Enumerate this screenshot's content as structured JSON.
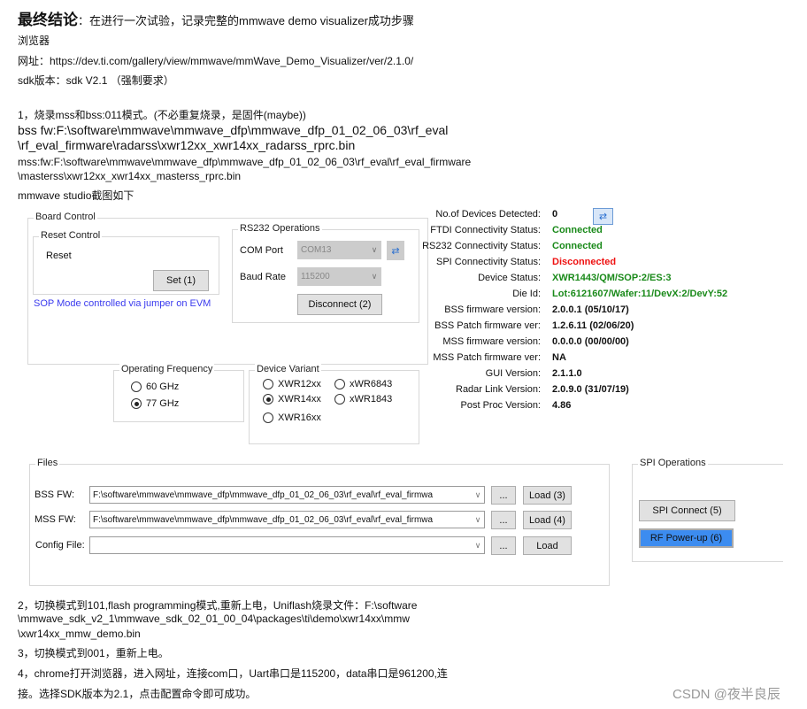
{
  "doc": {
    "title_bold": "最终结论",
    "title_rest": "：在进行一次试验，记录完整的mmwave demo visualizer成功步骤",
    "browser": "浏览器",
    "url_line": "网址：https://dev.ti.com/gallery/view/mmwave/mmWave_Demo_Visualizer/ver/2.1.0/",
    "sdk_line": "sdk版本：sdk V2.1 （强制要求）",
    "step1": "1，烧录mss和bss:011模式。(不必重复烧录，是固件(maybe))",
    "bss_fw_1": "bss fw:F:\\software\\mmwave\\mmwave_dfp\\mmwave_dfp_01_02_06_03\\rf_eval",
    "bss_fw_2": "\\rf_eval_firmware\\radarss\\xwr12xx_xwr14xx_radarss_rprc.bin",
    "mss_fw_1": "mss:fw:F:\\software\\mmwave\\mmwave_dfp\\mmwave_dfp_01_02_06_03\\rf_eval\\rf_eval_firmware",
    "mss_fw_2": "\\masterss\\xwr12xx_xwr14xx_masterss_rprc.bin",
    "studio_caption": "mmwave studio截图如下",
    "step2_1": "2，切换模式到101,flash programming模式,重新上电，Uniflash烧录文件：F:\\software",
    "step2_2": "\\mmwave_sdk_v2_1\\mmwave_sdk_02_01_00_04\\packages\\ti\\demo\\xwr14xx\\mmw",
    "step2_3": "\\xwr14xx_mmw_demo.bin",
    "step3": "3，切换模式到001，重新上电。",
    "step4_1": "4，chrome打开浏览器，进入网址，连接com口，Uart串口是115200，data串口是961200,连",
    "step4_2": "接。选择SDK版本为2.1，点击配置命令即可成功。",
    "watermark": "CSDN @夜半良辰"
  },
  "studio": {
    "board_control": "Board Control",
    "reset_control": "Reset Control",
    "reset_label": "Reset",
    "set_button": "Set (1)",
    "sop_note": "SOP Mode controlled via jumper on EVM",
    "rs232": "RS232 Operations",
    "com_port_label": "COM Port",
    "com_port_value": "COM13",
    "baud_label": "Baud Rate",
    "baud_value": "115200",
    "disconnect_button": "Disconnect (2)",
    "op_freq": "Operating Frequency",
    "freq_options": [
      {
        "label": "60 GHz",
        "selected": false
      },
      {
        "label": "77 GHz",
        "selected": true
      }
    ],
    "device_variant": "Device Variant",
    "variants": [
      {
        "label": "XWR12xx",
        "selected": false
      },
      {
        "label": "xWR6843",
        "selected": false
      },
      {
        "label": "XWR14xx",
        "selected": true
      },
      {
        "label": "xWR1843",
        "selected": false
      },
      {
        "label": "XWR16xx",
        "selected": false
      }
    ],
    "status": [
      {
        "label": "No.of Devices Detected:",
        "value": "0",
        "color": "#111111"
      },
      {
        "label": "FTDI Connectivity Status:",
        "value": "Connected",
        "color": "#1a8a1a"
      },
      {
        "label": "RS232 Connectivity Status:",
        "value": "Connected",
        "color": "#1a8a1a"
      },
      {
        "label": "SPI Connectivity Status:",
        "value": "Disconnected",
        "color": "#ee1111"
      },
      {
        "label": "Device Status:",
        "value": "XWR1443/QM/SOP:2/ES:3",
        "color": "#1a8a1a"
      },
      {
        "label": "Die Id:",
        "value": "Lot:6121607/Wafer:11/DevX:2/DevY:52",
        "color": "#1a8a1a"
      },
      {
        "label": "BSS firmware version:",
        "value": "2.0.0.1 (05/10/17)",
        "color": "#111111"
      },
      {
        "label": "BSS Patch firmware ver:",
        "value": "1.2.6.11 (02/06/20)",
        "color": "#111111"
      },
      {
        "label": "MSS firmware version:",
        "value": "0.0.0.0 (00/00/00)",
        "color": "#111111"
      },
      {
        "label": "MSS Patch firmware ver:",
        "value": "NA",
        "color": "#111111"
      },
      {
        "label": "GUI Version:",
        "value": "2.1.1.0",
        "color": "#111111"
      },
      {
        "label": "Radar Link Version:",
        "value": "2.0.9.0 (31/07/19)",
        "color": "#111111"
      },
      {
        "label": "Post Proc Version:",
        "value": "4.86",
        "color": "#111111"
      }
    ],
    "files": "Files",
    "file_rows": [
      {
        "label": "BSS FW:",
        "value": "F:\\software\\mmwave\\mmwave_dfp\\mmwave_dfp_01_02_06_03\\rf_eval\\rf_eval_firmwa",
        "browse": "...",
        "load": "Load (3)"
      },
      {
        "label": "MSS FW:",
        "value": "F:\\software\\mmwave\\mmwave_dfp\\mmwave_dfp_01_02_06_03\\rf_eval\\rf_eval_firmwa",
        "browse": "...",
        "load": "Load (4)"
      },
      {
        "label": "Config File:",
        "value": "",
        "browse": "...",
        "load": "Load"
      }
    ],
    "spi_ops": "SPI Operations",
    "spi_connect": "SPI Connect (5)",
    "rf_powerup": "RF Power-up (6)",
    "accent": "#3c8cf0"
  }
}
